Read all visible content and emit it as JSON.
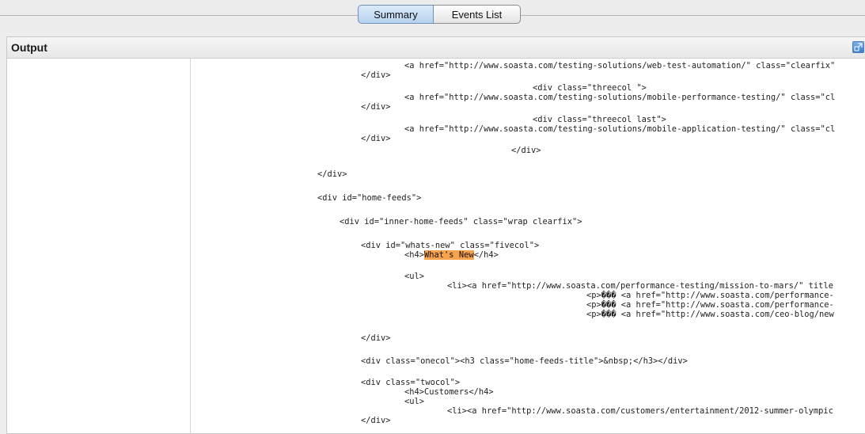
{
  "tabs": {
    "summary_label": "Summary",
    "events_label": "Events List"
  },
  "panel": {
    "title": "Output"
  },
  "code": {
    "l1": "<a href=\"http://www.soasta.com/testing-solutions/web-test-automation/\" class=\"clearfix\"",
    "l2": "</div>",
    "l3": "<div class=\"threecol \">",
    "l4": "<a href=\"http://www.soasta.com/testing-solutions/mobile-performance-testing/\" class=\"cl",
    "l5": "</div>",
    "l6": "<div class=\"threecol last\">",
    "l7": "<a href=\"http://www.soasta.com/testing-solutions/mobile-application-testing/\" class=\"cl",
    "l8": "</div>",
    "l9": "</div>",
    "l10": "</div>",
    "l11": "<div id=\"home-feeds\">",
    "l12": "<div id=\"inner-home-feeds\" class=\"wrap clearfix\">",
    "l13": "<div id=\"whats-new\" class=\"fivecol\">",
    "l14_pre": "<h4>",
    "l14_hl": "What's New",
    "l14_post": "</h4>",
    "l15": "<ul>",
    "l16": "<li><a href=\"http://www.soasta.com/performance-testing/mission-to-mars/\" title",
    "l17": "<p>��� <a href=\"http://www.soasta.com/performance-",
    "l18": "<p>��� <a href=\"http://www.soasta.com/performance-",
    "l19": "<p>��� <a href=\"http://www.soasta.com/ceo-blog/new",
    "l20": "</div>",
    "l21": "<div class=\"onecol\"><h3 class=\"home-feeds-title\">&nbsp;</h3></div>",
    "l22": "<div class=\"twocol\">",
    "l23": "<h4>Customers</h4>",
    "l24": "<ul>",
    "l25": "<li><a href=\"http://www.soasta.com/customers/entertainment/2012-summer-olympic",
    "l26": "</div>"
  }
}
